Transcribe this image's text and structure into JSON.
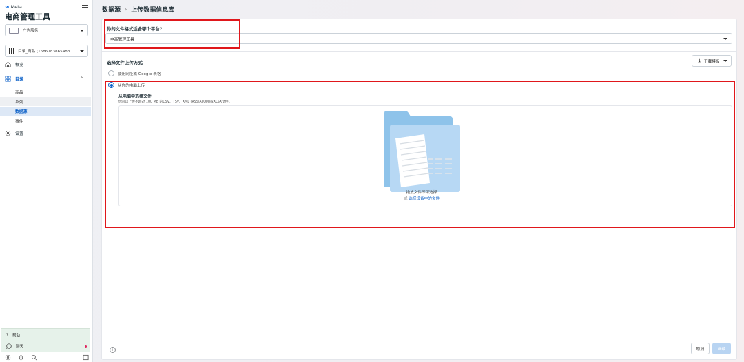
{
  "brand": {
    "meta_label": "Meta",
    "app_title": "电商管理工具"
  },
  "sidebar": {
    "ad_account": "广告服务",
    "catalog": "目录_商品 (1686783865483…",
    "nav": {
      "overview": "概览",
      "catalog": "目录",
      "sub_items": [
        "商品",
        "系列",
        "数据源",
        "事件"
      ],
      "settings": "设置"
    },
    "help": "帮助",
    "chat": "聊天"
  },
  "breadcrumb": {
    "root": "数据源",
    "separator": "›",
    "current": "上传数据信息库"
  },
  "form": {
    "platform_question": "你的文件格式适合哪个平台?",
    "platform_value": "电商管理工具",
    "method_title": "选择文件上传方式",
    "download_template": "下载模板",
    "options": {
      "web_or_google": "使用网址或 Google 表格",
      "from_computer": "从你的电脑上传"
    },
    "upload_title": "从电脑中选择文件",
    "upload_desc": "你可以上传不超过 100 MB 的CSV、TSV、XML (RSS/ATOM)或XLSX文件。",
    "drop_hint": "拖放文件即可选择",
    "drop_or": "或 ",
    "drop_link": "选择设备中的文件"
  },
  "actions": {
    "cancel": "取消",
    "next": "继续"
  },
  "colors": {
    "accent": "#0a5fc7",
    "highlight": "#e0171b",
    "folder": "#a9d1f2"
  }
}
